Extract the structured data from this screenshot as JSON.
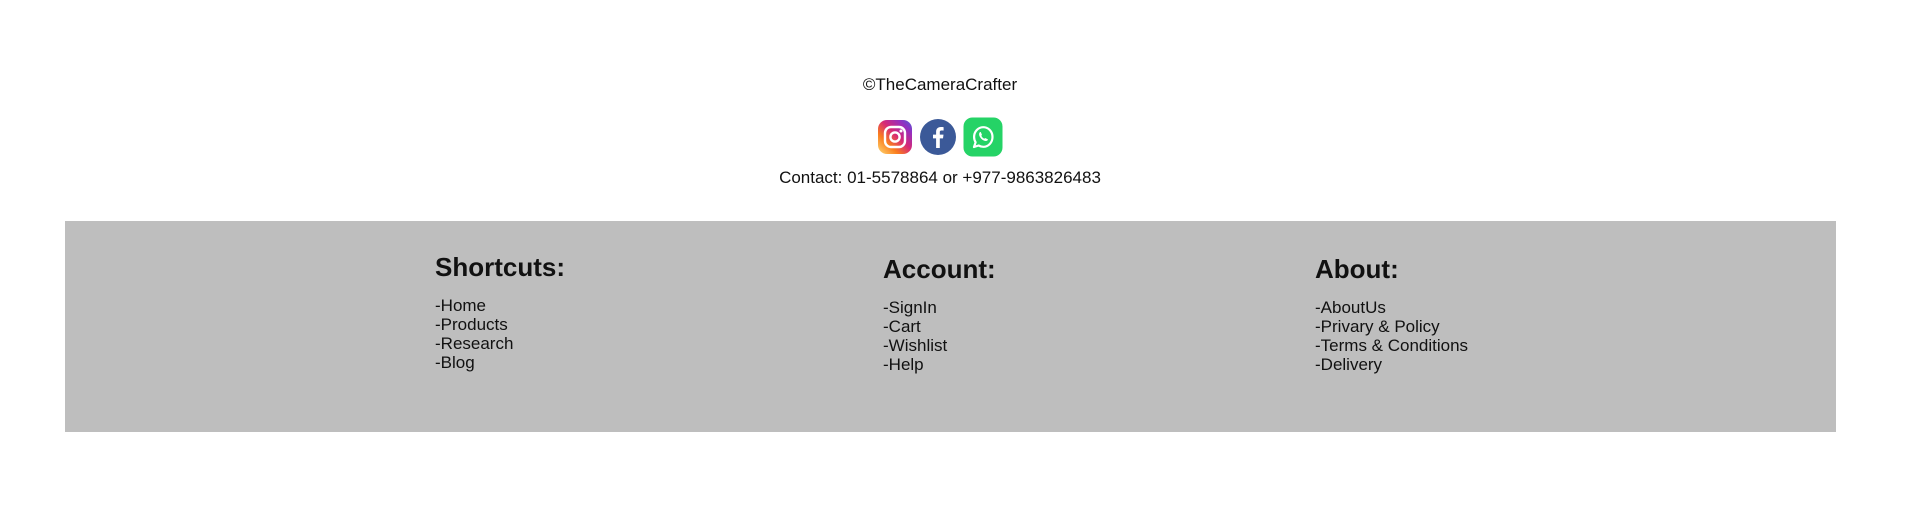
{
  "site": {
    "copyright": "©TheCameraCrafter",
    "contact": "Contact: 01-5578864 or +977-9863826483"
  },
  "socials": [
    {
      "name": "Instagram",
      "icon": "instagram-icon",
      "colors": [
        "#feda75",
        "#fa7e1e",
        "#d62976",
        "#962fbf",
        "#4f5bd5"
      ]
    },
    {
      "name": "Facebook",
      "icon": "facebook-icon",
      "colors": [
        "#3b5998"
      ]
    },
    {
      "name": "WhatsApp",
      "icon": "whatsapp-icon",
      "colors": [
        "#25d366"
      ]
    }
  ],
  "footer": {
    "background": "#bebebe",
    "shortcuts": {
      "heading": "Shortcuts:",
      "items": [
        "-Home",
        "-Products",
        "-Research",
        "-Blog"
      ]
    },
    "account": {
      "heading": "Account:",
      "items": [
        "-SignIn",
        "-Cart",
        "-Wishlist",
        "-Help"
      ]
    },
    "about": {
      "heading": "About:",
      "items": [
        "-AboutUs",
        "-Privary & Policy",
        "-Terms & Conditions",
        "-Delivery"
      ]
    }
  }
}
